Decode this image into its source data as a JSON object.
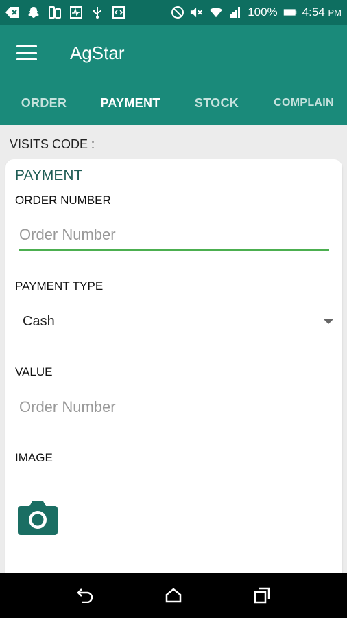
{
  "status_bar": {
    "battery": "100%",
    "time": "4:54",
    "ampm": "PM",
    "icons": [
      "back-arrow-icon",
      "snapchat-icon",
      "tablet-icon",
      "pulse-icon",
      "usb-icon",
      "code-icon",
      "do-not-disturb-icon",
      "mute-icon",
      "wifi-icon",
      "signal-icon",
      "battery-icon"
    ]
  },
  "app_bar": {
    "title": "AgStar",
    "menu_icon": "menu-icon"
  },
  "tabs": [
    {
      "label": "ORDER",
      "active": false
    },
    {
      "label": "PAYMENT",
      "active": true
    },
    {
      "label": "STOCK",
      "active": false
    },
    {
      "label": "COMPLAIN",
      "active": false
    }
  ],
  "visits_code_label": "VISITS CODE :",
  "card": {
    "title": "PAYMENT",
    "order_number": {
      "label": "ORDER NUMBER",
      "placeholder": "Order Number"
    },
    "payment_type": {
      "label": "PAYMENT TYPE",
      "value": "Cash"
    },
    "value_field": {
      "label": "VALUE",
      "placeholder": "Order Number"
    },
    "image": {
      "label": "IMAGE",
      "button_icon": "camera-icon"
    }
  },
  "nav_bar": {
    "icons": [
      "back-icon",
      "home-icon",
      "recents-icon"
    ]
  },
  "colors": {
    "status_bar": "#0e6e60",
    "app_bar": "#1a8a7a",
    "accent": "#4caf50",
    "card_title": "#1f5d55"
  }
}
